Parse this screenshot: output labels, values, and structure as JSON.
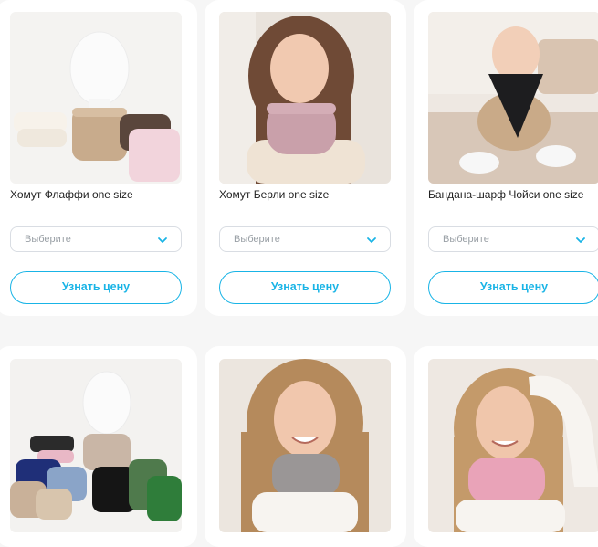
{
  "products": [
    {
      "title": "Хомут Флаффи one size",
      "select_placeholder": "Выберите",
      "button_label": "Узнать цену"
    },
    {
      "title": "Хомут Берли one size",
      "select_placeholder": "Выберите",
      "button_label": "Узнать цену"
    },
    {
      "title": "Бандана-шарф Чойси one size",
      "select_placeholder": "Выберите",
      "button_label": "Узнать цену"
    },
    {
      "title": "",
      "select_placeholder": "",
      "button_label": ""
    },
    {
      "title": "",
      "select_placeholder": "",
      "button_label": ""
    },
    {
      "title": "",
      "select_placeholder": "",
      "button_label": ""
    }
  ],
  "colors": {
    "accent": "#19b4e6",
    "card_bg": "#ffffff",
    "page_bg": "#f6f6f6"
  },
  "icons": {
    "select_arrow": "chevron-down-icon"
  }
}
